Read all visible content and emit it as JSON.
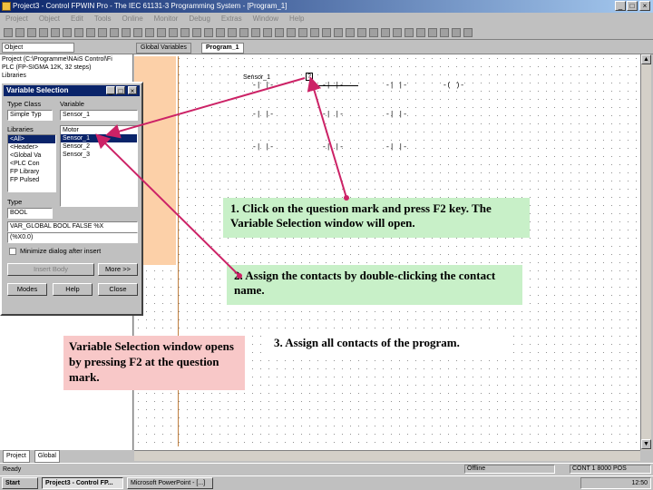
{
  "window": {
    "title": "Project3 - Control FPWIN Pro - The IEC 61131-3 Programming System - [Program_1]"
  },
  "menu": [
    "Project",
    "Object",
    "Edit",
    "Tools",
    "Online",
    "Monitor",
    "Debug",
    "Extras",
    "Window",
    "Help"
  ],
  "tabs": {
    "combo": "Object",
    "global": "Global Variables",
    "program": "Program_1"
  },
  "tree": {
    "lines": [
      "Project (C:\\Programme\\NAiS Control\\Fi",
      "PLC (FP-SIGMA 12K, 32 steps)",
      "Libraries"
    ]
  },
  "dialog": {
    "title": "Variable Selection",
    "type_class_label": "Type Class",
    "type_class_value": "Simple Typ",
    "variable_label": "Variable",
    "variable_value": "Sensor_1",
    "libraries_label": "Libraries",
    "libraries": [
      "<All>",
      "<Header>",
      "<Global Va",
      "<PLC Con",
      "FP Library",
      "FP Pulsed"
    ],
    "type_label": "Type",
    "type_value": "BOOL",
    "variables": [
      "Motor",
      "Sensor_1",
      "Sensor_2",
      "Sensor_3"
    ],
    "declaration": "VAR_GLOBAL BOOL FALSE %X",
    "declaration2": "(%X0.0)",
    "minimize_label": "Minimize dialog after insert",
    "insert_button": "Insert Body",
    "more_button": "More >>",
    "modes_button": "Modes",
    "help_button": "Help",
    "close_button": "Close"
  },
  "ladder": {
    "sensor_label": "Sensor_1",
    "qmark": "?"
  },
  "bottom_tabs": [
    "Project",
    "Global"
  ],
  "status": {
    "left": "Ready",
    "mid": "Offline",
    "right": "CONT 1 8000 POS"
  },
  "taskbar": {
    "start": "Start",
    "task1": "Project3 - Control FP...",
    "task2": "Microsoft PowerPoint - [...]",
    "clock": "12:50"
  },
  "callouts": {
    "step1": "1. Click on the question mark and press F2 key. The Variable Selection window will open.",
    "step2": "2. Assign the contacts by double-clicking the contact name.",
    "step3": "3. Assign all contacts of the program.",
    "note": "Variable Selection window opens by pressing F2 at the question mark."
  },
  "colors": {
    "arrow": "#cc2266",
    "callout_green": "#c8f0c8",
    "callout_pink": "#f8c8c8"
  }
}
